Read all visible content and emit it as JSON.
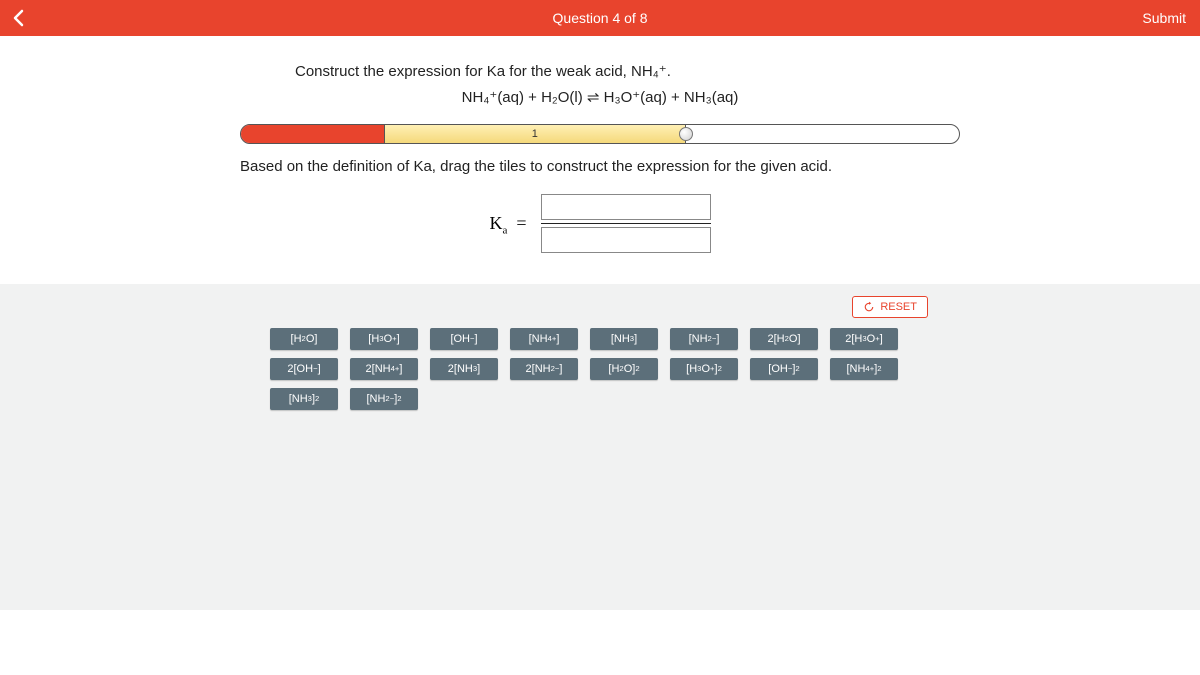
{
  "header": {
    "title": "Question 4 of 8",
    "submit": "Submit"
  },
  "prompt": "Construct the expression for Ka for the weak acid, NH₄⁺.",
  "equation": "NH₄⁺(aq) + H₂O(l) ⇌ H₃O⁺(aq) + NH₃(aq)",
  "progress": {
    "current_label": "1"
  },
  "instruction": "Based on the definition of Ka, drag the tiles to construct the expression for the given acid.",
  "ka_label_html": "K<sub>a</sub>&nbsp;&nbsp;=",
  "reset_label": "RESET",
  "tiles": [
    "[H₂O]",
    "[H₃O⁺]",
    "[OH⁻]",
    "[NH₄⁺]",
    "[NH₃]",
    "[NH₂⁻]",
    "2[H₂O]",
    "2[H₃O⁺]",
    "2[OH⁻]",
    "2[NH₄⁺]",
    "2[NH₃]",
    "2[NH₂⁻]",
    "[H₂O]²",
    "[H₃O⁺]²",
    "[OH⁻]²",
    "[NH₄⁺]²",
    "[NH₃]²",
    "[NH₂⁻]²"
  ]
}
